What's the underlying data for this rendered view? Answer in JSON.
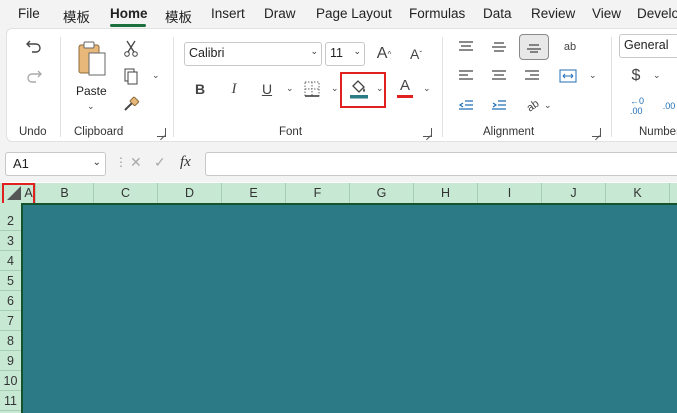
{
  "menu": {
    "file": "File",
    "tab1": "模板",
    "home": "Home",
    "tab2": "模板",
    "insert": "Insert",
    "draw": "Draw",
    "page_layout": "Page Layout",
    "formulas": "Formulas",
    "data": "Data",
    "review": "Review",
    "view": "View",
    "developer": "Develo"
  },
  "ribbon": {
    "undo_group": "Undo",
    "clipboard_group": "Clipboard",
    "paste_label": "Paste",
    "font_group": "Font",
    "font_name": "Calibri",
    "font_size": "11",
    "bold": "B",
    "italic": "I",
    "underline": "U",
    "font_color_letter": "A",
    "grow_font": "A",
    "shrink_font": "A",
    "alignment_group": "Alignment",
    "number_group": "Number",
    "number_format": "General",
    "currency_symbol": "$",
    "fill_color": "#2b7a85",
    "font_color": "#e12020"
  },
  "formula_bar": {
    "name_box": "A1",
    "fx": "fx",
    "value": ""
  },
  "columns": [
    "A",
    "B",
    "C",
    "D",
    "E",
    "F",
    "G",
    "H",
    "I",
    "J",
    "K"
  ],
  "rows": [
    "2",
    "3",
    "4",
    "5",
    "6",
    "7",
    "8",
    "9",
    "10",
    "11"
  ],
  "sheet": {
    "fill": "#2b7a85",
    "header_fill": "#c7e9d4",
    "accent": "#1e6f3e",
    "highlight": "#e12020"
  }
}
